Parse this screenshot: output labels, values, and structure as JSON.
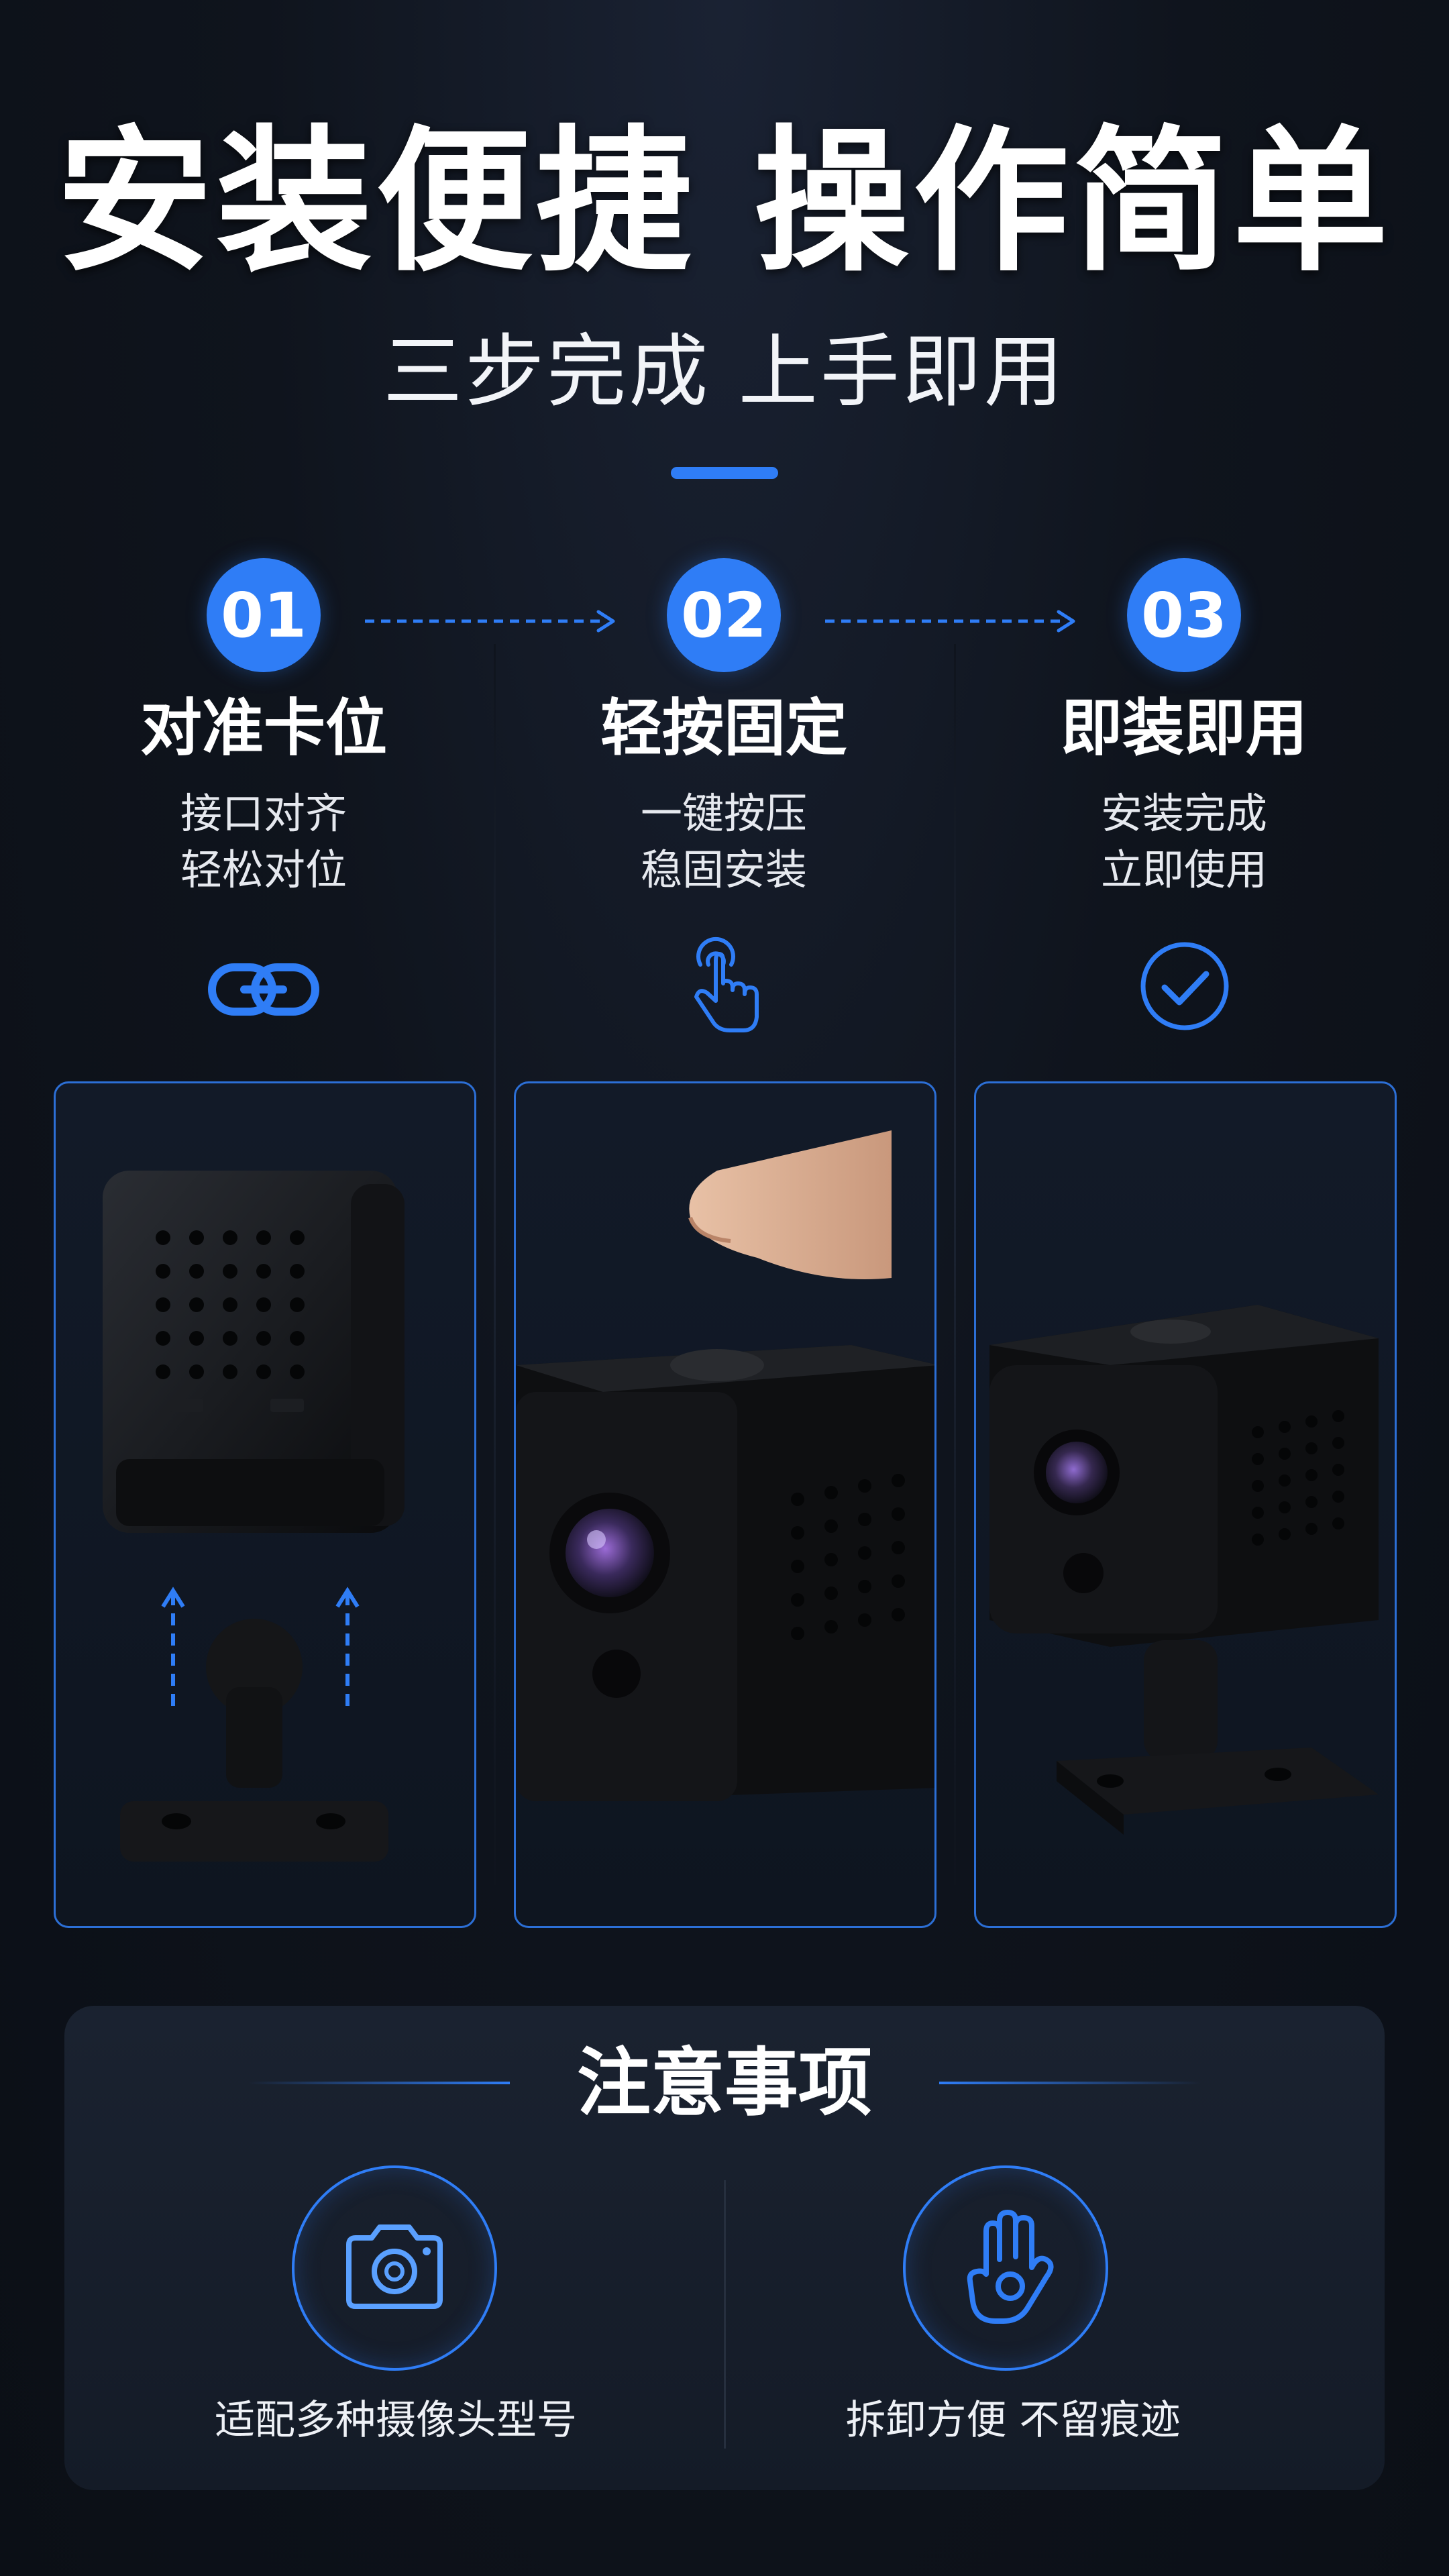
{
  "header": {
    "title": "安装便捷 操作简单",
    "subtitle": "三步完成 上手即用"
  },
  "steps": [
    {
      "number": "01",
      "title": "对准卡位",
      "desc_line1": "接口对齐",
      "desc_line2": "轻松对位",
      "icon": "link-icon"
    },
    {
      "number": "02",
      "title": "轻按固定",
      "desc_line1": "一键按压",
      "desc_line2": "稳固安装",
      "icon": "hand-tap-icon"
    },
    {
      "number": "03",
      "title": "即装即用",
      "desc_line1": "安装完成",
      "desc_line2": "立即使用",
      "icon": "check-circle-icon"
    }
  ],
  "notice": {
    "title": "注意事项",
    "items": [
      {
        "label": "适配多种摄像头型号",
        "icon": "camera-icon"
      },
      {
        "label": "拆卸方便 不留痕迹",
        "icon": "ok-hand-icon"
      }
    ]
  },
  "colors": {
    "accent": "#2f7df6",
    "background": "#0f141d",
    "panel": "#171f2c"
  }
}
